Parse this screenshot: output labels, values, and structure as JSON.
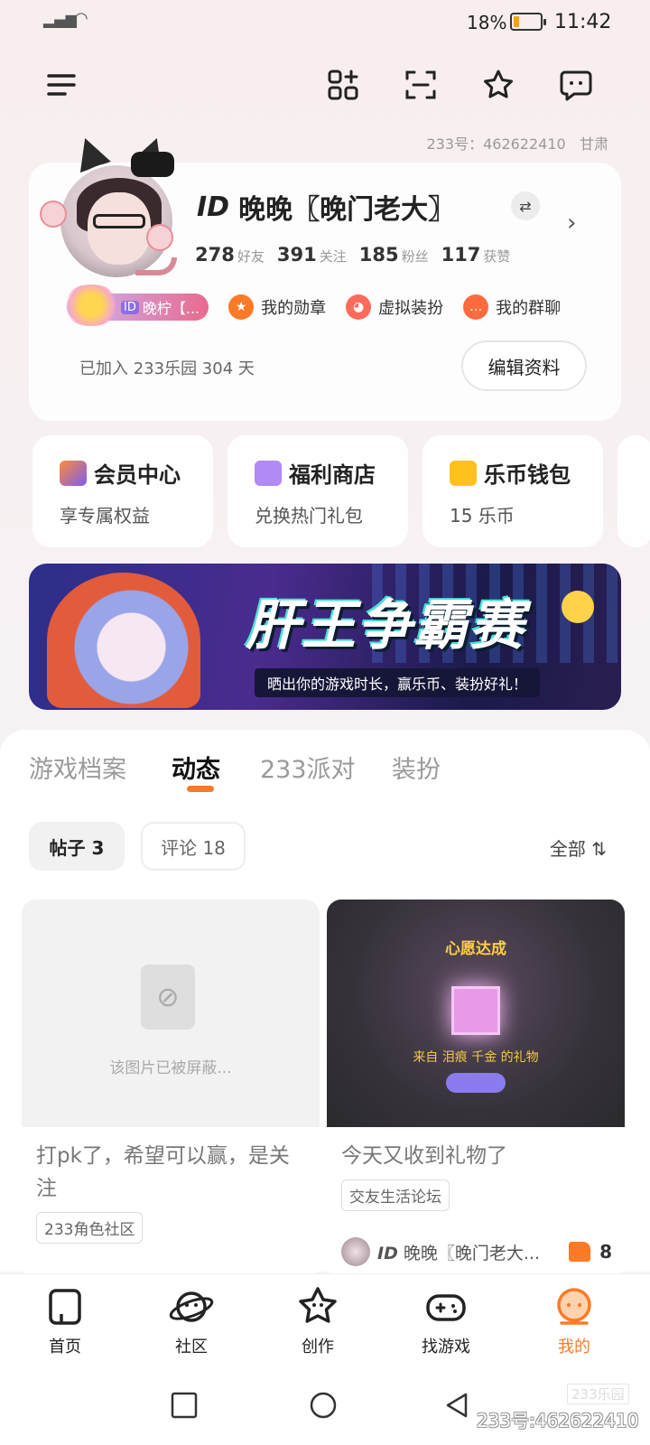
{
  "status_bar": {
    "battery_pct": "18%",
    "time": "11:42"
  },
  "header": {
    "uid_label": "233号：462622410",
    "region": "甘肃"
  },
  "profile": {
    "id_prefix": "ID",
    "name": "晚晚〖晚门老大〗",
    "stats": [
      {
        "num": "278",
        "label": "好友"
      },
      {
        "num": "391",
        "label": "关注"
      },
      {
        "num": "185",
        "label": "粉丝"
      },
      {
        "num": "117",
        "label": "获赞"
      }
    ],
    "medal_tag": "晚柠【...",
    "medal_id": "ID",
    "links": [
      {
        "label": "我的勋章",
        "color": "#ff7a26"
      },
      {
        "label": "虚拟装扮",
        "color": "#ff6a5a"
      },
      {
        "label": "我的群聊",
        "color": "#ff6b3d"
      }
    ],
    "joined": "已加入 233乐园 304 天",
    "edit_label": "编辑资料"
  },
  "quick_cards": [
    {
      "title": "会员中心",
      "sub": "享专属权益",
      "color": "#7a5cf0"
    },
    {
      "title": "福利商店",
      "sub": "兑换热门礼包",
      "color": "#b28af5"
    },
    {
      "title": "乐币钱包",
      "sub": "15 乐币",
      "color": "#ffc21a"
    }
  ],
  "banner": {
    "title": "肝王争霸赛",
    "sub": "晒出你的游戏时长，赢乐币、装扮好礼！"
  },
  "tabs": [
    {
      "label": "游戏档案"
    },
    {
      "label": "动态"
    },
    {
      "label": "233派对"
    },
    {
      "label": "装扮"
    }
  ],
  "chips": {
    "posts": "帖子 3",
    "comments": "评论 18",
    "filter": "全部 ⇅"
  },
  "posts": [
    {
      "blocked_text": "该图片已被屏蔽...",
      "title": "打pk了，希望可以赢，是关注",
      "tag": "233角色社区"
    },
    {
      "wish_title": "心愿达成",
      "wish_from": "来自 泪痕 千金 的礼物",
      "title": "今天又收到礼物了",
      "tag": "交友生活论坛",
      "author_prefix": "ID",
      "author_name": "晚晚〖晚门老大...",
      "likes": "8"
    }
  ],
  "bottom_nav": [
    {
      "label": "首页"
    },
    {
      "label": "社区"
    },
    {
      "label": "创作"
    },
    {
      "label": "找游戏"
    },
    {
      "label": "我的"
    }
  ],
  "watermark": {
    "box": "233乐园",
    "text": "233号:462622410"
  },
  "accent_color": "#ff7a26"
}
